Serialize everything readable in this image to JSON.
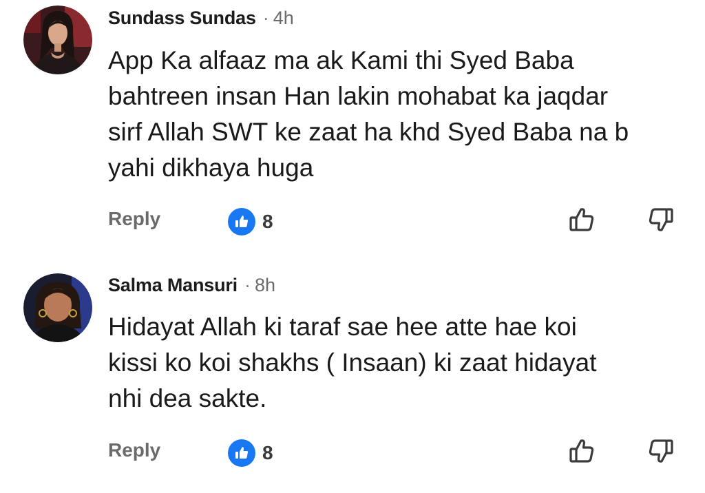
{
  "comments": [
    {
      "author": "Sundass Sundas",
      "time": "4h",
      "text": "App Ka alfaaz ma ak Kami thi Syed Baba\nbahtreen insan Han lakin mohabat ka jaqdar\nsirf Allah SWT ke zaat ha khd Syed Baba na b\nyahi dikhaya huga",
      "reply_label": "Reply",
      "reaction_count": "8"
    },
    {
      "author": "Salma Mansuri",
      "time": "8h",
      "text": "Hidayat Allah ki taraf sae hee atte hae koi\nkissi ko koi shakhs ( Insaan) ki zaat hidayat\nnhi dea sakte.",
      "reply_label": "Reply",
      "reaction_count": "8"
    }
  ],
  "separator": "·",
  "icons": {
    "like_badge": "thumbs-up-icon",
    "upvote": "thumbs-up-outline-icon",
    "downvote": "thumbs-down-outline-icon"
  },
  "colors": {
    "like_badge": "#1877f2",
    "author": "#1c1c1c",
    "meta": "#6b6b6b",
    "text": "#1a1a1a"
  }
}
